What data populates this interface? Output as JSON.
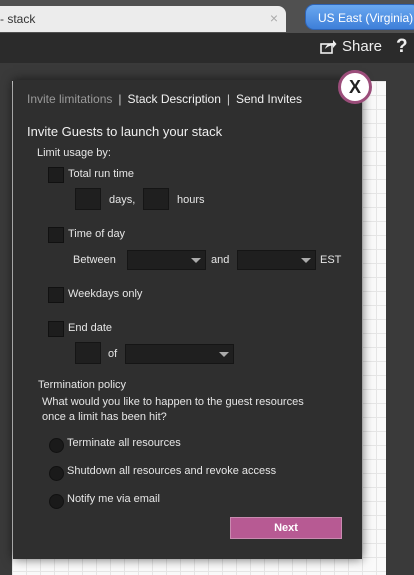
{
  "browser": {
    "tab_title": "- stack",
    "tab_close": "×",
    "region": "US East (Virginia)"
  },
  "toolbar": {
    "share_label": "Share",
    "help_label": "?"
  },
  "modal": {
    "close_label": "X",
    "nav": {
      "invite_limitations": "Invite limitations",
      "stack_description": "Stack Description",
      "send_invites": "Send Invites",
      "separator": "|"
    },
    "title": "Invite Guests to launch your stack",
    "limit_usage_label": "Limit usage by:",
    "total_run_time": {
      "label": "Total run time",
      "days_suffix": "days,",
      "hours_suffix": "hours"
    },
    "time_of_day": {
      "label": "Time of day",
      "between_label": "Between",
      "and_label": "and",
      "tz_label": "EST"
    },
    "weekdays_only": {
      "label": "Weekdays only"
    },
    "end_date": {
      "label": "End date",
      "of_label": "of"
    },
    "termination": {
      "heading": "Termination policy",
      "question_line1": "What would you like to happen to the guest resources",
      "question_line2": "once a limit has been hit?",
      "options": [
        "Terminate all resources",
        "Shutdown all resources and revoke access",
        "Notify me via email"
      ]
    },
    "next_label": "Next"
  },
  "colors": {
    "accent_button": "#b75a93",
    "modal_bg": "#2f2f2f",
    "region_button": "#4a8ae0"
  }
}
